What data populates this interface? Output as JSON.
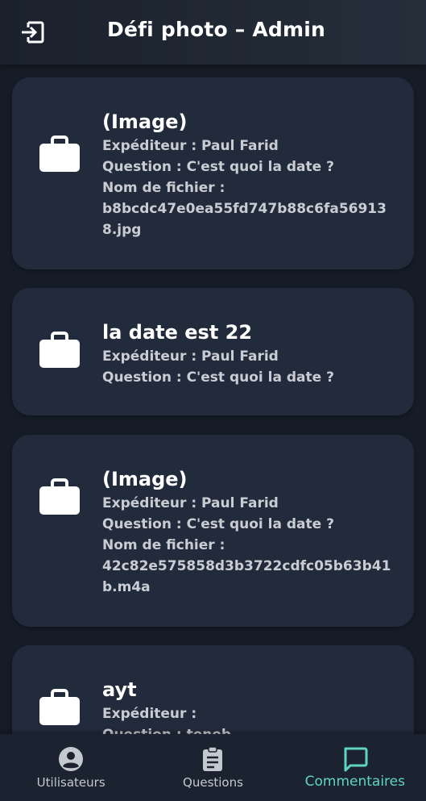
{
  "app_bar": {
    "title": "Défi photo – Admin",
    "exit_icon": "logout-icon"
  },
  "field_labels": {
    "sender": "Expéditeur :",
    "question": "Question :",
    "filename": "Nom de fichier :"
  },
  "cards": [
    {
      "icon": "briefcase-icon",
      "title": "(Image)",
      "sender_line": "Expéditeur : Paul Farid",
      "question_line": "Question : C'est quoi la date ?",
      "filename_label": "Nom de fichier :",
      "filename": "b8bcdc47e0ea55fd747b88c6fa569138.jpg"
    },
    {
      "icon": "briefcase-icon",
      "title": "la date est 22",
      "sender_line": "Expéditeur : Paul Farid",
      "question_line": "Question : C'est quoi la date ?"
    },
    {
      "icon": "briefcase-icon",
      "title": "(Image)",
      "sender_line": "Expéditeur : Paul Farid",
      "question_line": "Question : C'est quoi la date ?",
      "filename_label": "Nom de fichier :",
      "filename": "42c82e575858d3b3722cdfc05b63b41b.m4a"
    },
    {
      "icon": "briefcase-icon",
      "title": "ayt",
      "sender_line": "Expéditeur :",
      "question_line": "Question : teneb"
    }
  ],
  "bottom_nav": {
    "items": [
      {
        "label": "Utilisateurs",
        "icon": "account-circle-icon",
        "active": false
      },
      {
        "label": "Questions",
        "icon": "clipboard-icon",
        "active": false
      },
      {
        "label": "Commentaires",
        "icon": "chat-bubble-icon",
        "active": true
      }
    ]
  },
  "colors": {
    "background": "#151c27",
    "card": "#222b3c",
    "accent": "#5fd4c4",
    "secondary_text": "#c9ccd3"
  }
}
